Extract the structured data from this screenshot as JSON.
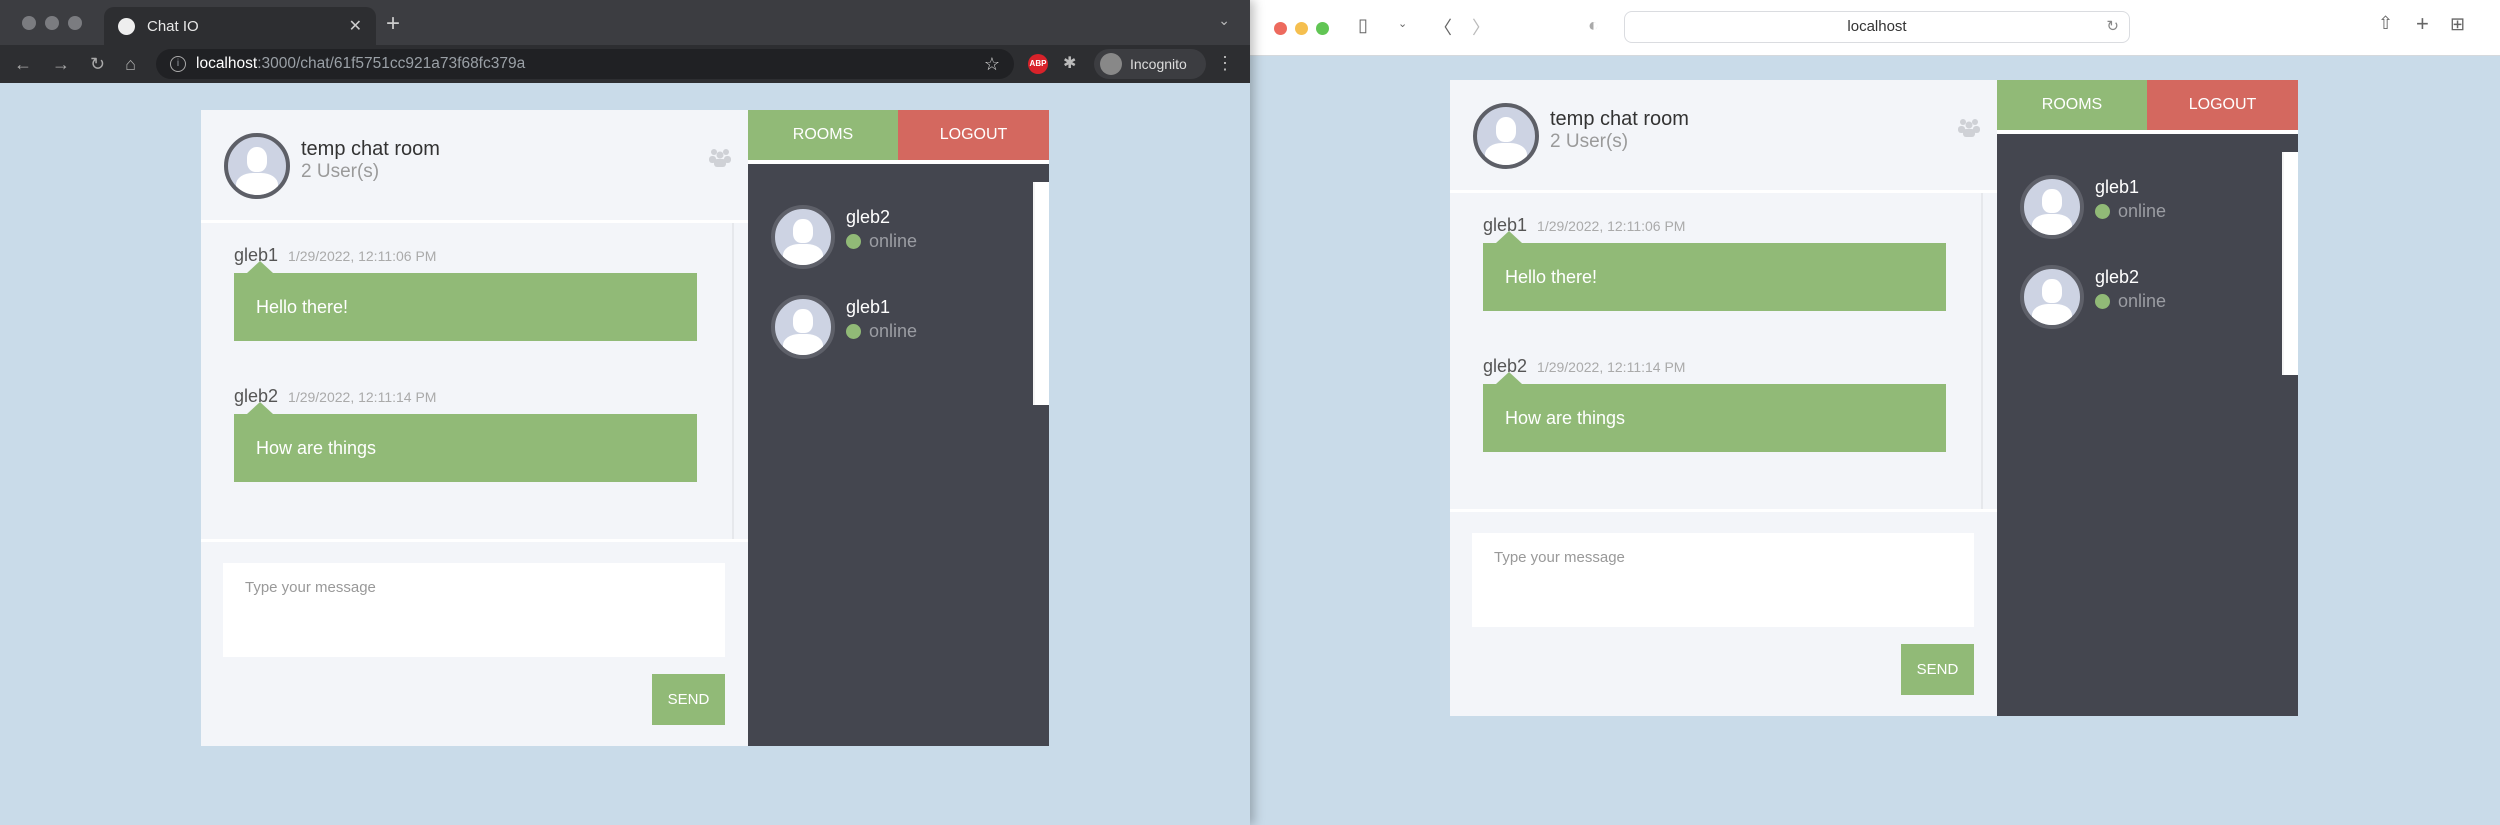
{
  "chrome": {
    "tab_title": "Chat IO",
    "url_host": "localhost",
    "url_rest": ":3000/chat/61f5751cc921a73f68fc379a",
    "incognito_label": "Incognito",
    "abp_label": "ABP"
  },
  "safari": {
    "url": "localhost"
  },
  "colors": {
    "green": "#91ba77",
    "red": "#d4685f",
    "dark": "#44464f",
    "page_bg": "#c9dbe9"
  },
  "left": {
    "room_title": "temp chat room",
    "room_users": "2 User(s)",
    "messages": [
      {
        "author": "gleb1",
        "time": "1/29/2022, 12:11:06 PM",
        "text": "Hello there!"
      },
      {
        "author": "gleb2",
        "time": "1/29/2022, 12:11:14 PM",
        "text": "How are things"
      }
    ],
    "input_placeholder": "Type your message",
    "send_label": "SEND",
    "rooms_label": "ROOMS",
    "logout_label": "LOGOUT",
    "users": [
      {
        "name": "gleb2",
        "status": "online"
      },
      {
        "name": "gleb1",
        "status": "online"
      }
    ]
  },
  "right": {
    "room_title": "temp chat room",
    "room_users": "2 User(s)",
    "messages": [
      {
        "author": "gleb1",
        "time": "1/29/2022, 12:11:06 PM",
        "text": "Hello there!"
      },
      {
        "author": "gleb2",
        "time": "1/29/2022, 12:11:14 PM",
        "text": "How are things"
      }
    ],
    "input_placeholder": "Type your message",
    "send_label": "SEND",
    "rooms_label": "ROOMS",
    "logout_label": "LOGOUT",
    "users": [
      {
        "name": "gleb1",
        "status": "online"
      },
      {
        "name": "gleb2",
        "status": "online"
      }
    ]
  }
}
